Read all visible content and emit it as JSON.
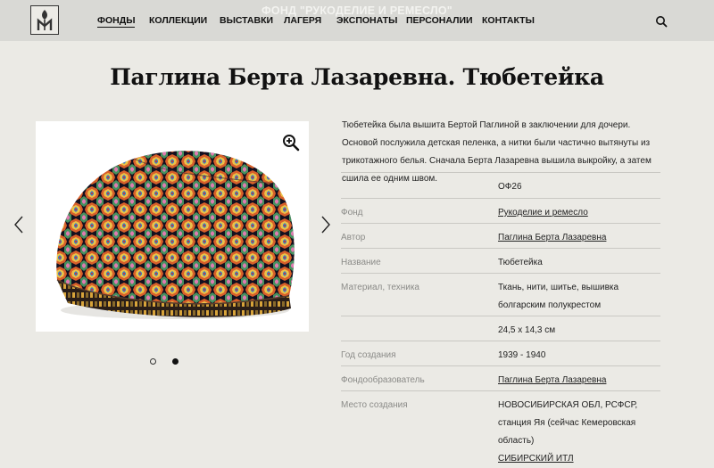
{
  "header": {
    "overlay_title": "ФОНД \"РУКОДЕЛИЕ И РЕМЕСЛО\"",
    "nav": [
      {
        "label": "ФОНДЫ",
        "active": true
      },
      {
        "label": "КОЛЛЕКЦИИ",
        "active": false
      },
      {
        "label": "ВЫСТАВКИ",
        "active": false
      },
      {
        "label": "ЛАГЕРЯ",
        "active": false
      },
      {
        "label": "ЭКСПОНАТЫ",
        "active": false
      },
      {
        "label": "ПЕРСОНАЛИИ",
        "active": false
      },
      {
        "label": "КОНТАКТЫ",
        "active": false
      }
    ],
    "search_icon": "search-icon",
    "logo_icon": "museum-logo"
  },
  "page": {
    "title": "Паглина Берта Лазаревна. Тюбетейка"
  },
  "gallery": {
    "slide_count": 2,
    "active_slide": 2,
    "zoom_icon": "zoom-in-icon",
    "prev_icon": "chevron-left-icon",
    "next_icon": "chevron-right-icon"
  },
  "description": "Тюбетейка была вышита Бертой Паглиной в заключении для дочери. Основой послужила детская пеленка, а нитки были частично вытянуты из трикотажного белья. Сначала Берта Лазаревна вышила выкройку, а затем сшила ее одним швом.",
  "properties": [
    {
      "label": "",
      "value": "ОФ26",
      "link": false
    },
    {
      "label": "Фонд",
      "value": "Рукоделие и ремесло",
      "link": true
    },
    {
      "label": "Автор",
      "value": "Паглина Берта Лазаревна",
      "link": true
    },
    {
      "label": "Название",
      "value": "Тюбетейка",
      "link": false
    },
    {
      "label": "Материал, техника",
      "value": "Ткань, нити, шитье, вышивка болгарским полукрестом",
      "link": false
    },
    {
      "label": "",
      "value": "24,5 х 14,3 см",
      "link": false
    },
    {
      "label": "Год создания",
      "value": "1939 - 1940",
      "link": false
    },
    {
      "label": "Фондообразователь",
      "value": "Паглина Берта Лазаревна",
      "link": true
    },
    {
      "label": "Место создания",
      "value": "НОВОСИБИРСКАЯ ОБЛ, РСФСР, станция Яя (сейчас Кемеровская область)",
      "link": false,
      "extra_link": "СИБИРСКИЙ ИТЛ"
    }
  ],
  "colors": {
    "background": "#ebeae5",
    "header": "#d9d9d5",
    "text": "#222222",
    "muted_label": "#8b8b88",
    "divider": "#c9c8c3"
  }
}
